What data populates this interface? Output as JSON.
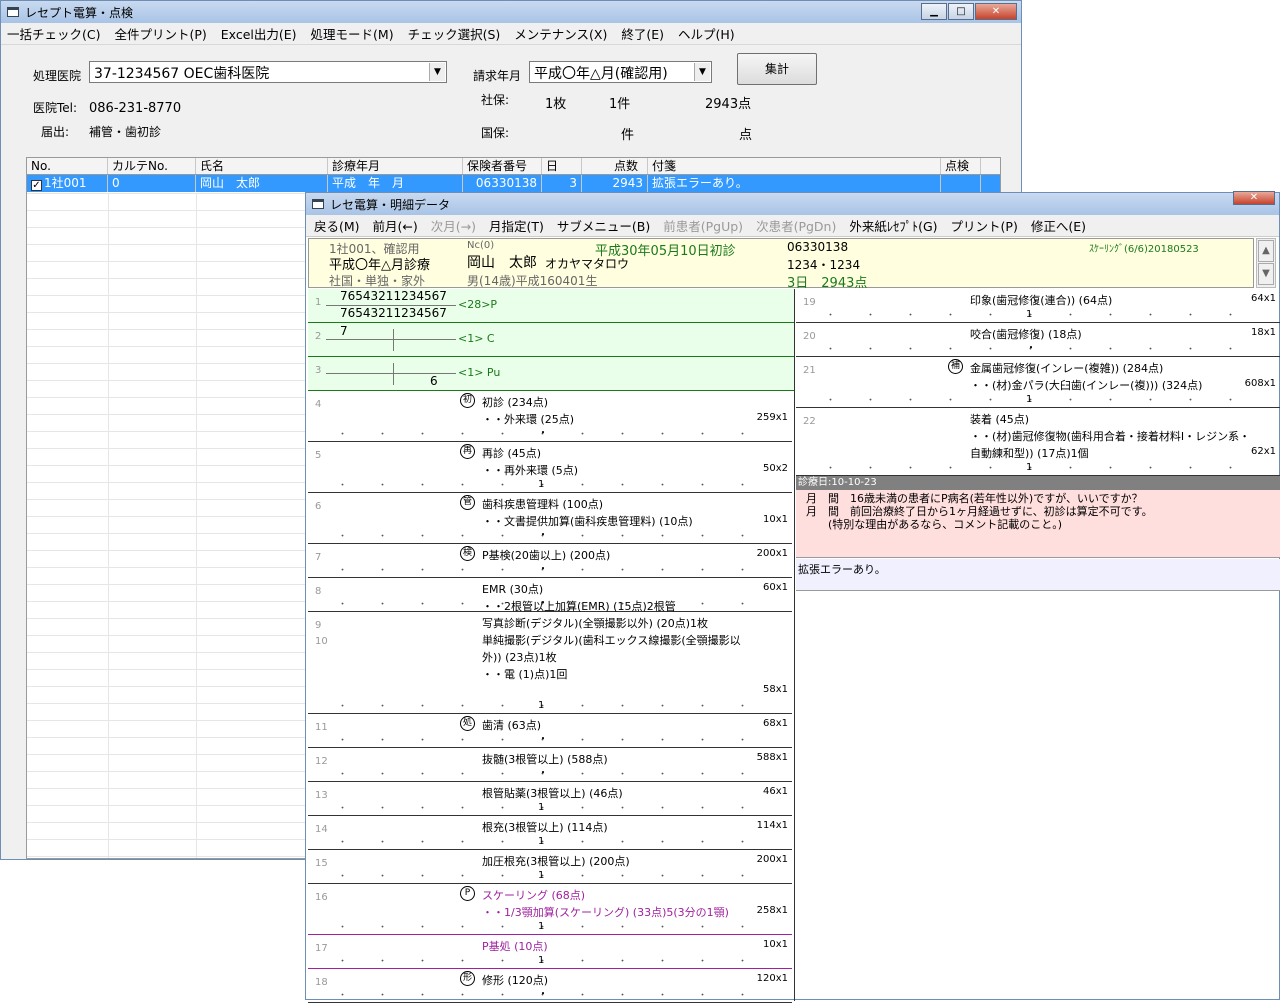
{
  "main": {
    "title": "レセプト電算・点検",
    "menu": [
      "一括チェック(C)",
      "全件プリント(P)",
      "Excel出力(E)",
      "処理モード(M)",
      "チェック選択(S)",
      "メンテナンス(X)",
      "終了(E)",
      "ヘルプ(H)"
    ],
    "clinic_label": "処理医院",
    "clinic_value": "37-1234567 OEC歯科医院",
    "month_label": "請求年月",
    "month_value": "平成〇年△月(確認用)",
    "tally_button": "集計",
    "tel_label": "医院Tel:",
    "tel_value": "086-231-8770",
    "notify_label": "届出:",
    "notify_value": "補管・歯初診",
    "shaho_label": "社保:",
    "shaho_sheets": "1枚",
    "shaho_cases": "1件",
    "shaho_points": "2943点",
    "kokuho_label": "国保:",
    "kokuho_cases": "件",
    "kokuho_points": "点",
    "columns": [
      "No.",
      "カルテNo.",
      "氏名",
      "診療年月",
      "保険者番号",
      "日",
      "点数",
      "付箋",
      "点検"
    ],
    "row": {
      "check": "✓",
      "no": "1社001",
      "chart": "0",
      "name": "岡山　太郎",
      "ym": "平成　年　月",
      "insurer": "06330138",
      "days": "3",
      "points": "2943",
      "tag": "拡張エラーあり。",
      "inspect": ""
    }
  },
  "detail": {
    "title": "レセ電算・明細データ",
    "menu": [
      {
        "label": "戻る(M)",
        "enabled": true
      },
      {
        "label": "前月(←)",
        "enabled": true
      },
      {
        "label": "次月(→)",
        "enabled": false
      },
      {
        "label": "月指定(T)",
        "enabled": true
      },
      {
        "label": "サブメニュー(B)",
        "enabled": true
      },
      {
        "label": "前患者(PgUp)",
        "enabled": false
      },
      {
        "label": "次患者(PgDn)",
        "enabled": false
      },
      {
        "label": "外来紙ﾚｾﾌﾟﾄ(G)",
        "enabled": true
      },
      {
        "label": "プリント(P)",
        "enabled": true
      },
      {
        "label": "修正へ(E)",
        "enabled": true
      }
    ],
    "info": {
      "line1": "1社001、確認用",
      "period": "平成〇年△月診療",
      "category": "社国・単独・家外",
      "nc": "Nc(0)",
      "patient": "岡山　太郎",
      "kana": "オカヤマタロウ",
      "sexage": "男(14歳)平成160401生",
      "firstvisit": "平成30年05月10日初診",
      "insurer": "06330138",
      "card": "1234・1234",
      "days_points": "3日　2943点",
      "scaling": "ｽｹｰﾘﾝｸﾞ(6/6)20180523"
    },
    "left_rows": [
      {
        "n": "1",
        "tooth_a": "76543211234567",
        "tooth_b": "76543211234567",
        "dx": "<28>P"
      },
      {
        "n": "2",
        "tooth_a": "7",
        "dx": "<1> C"
      },
      {
        "n": "3",
        "tooth_b": "6",
        "dx": "<1> Pu"
      },
      {
        "n": "4",
        "badge": "初",
        "l1": "初診 (234点)",
        "l2": "・・外来環 (25点)",
        "count": "259x1",
        "mark": "・"
      },
      {
        "n": "5",
        "badge": "再",
        "l1": "再診 (45点)",
        "l2": "・・再外来環 (5点)",
        "count": "50x2",
        "mark": "1"
      },
      {
        "n": "6",
        "badge": "管",
        "l1": "歯科疾患管理料 (100点)",
        "l2": "・・文書提供加算(歯科疾患管理料) (10点)",
        "count": "10x1",
        "mark": "・"
      },
      {
        "n": "7",
        "badge": "検",
        "l1": "P基検(20歯以上) (200点)",
        "count": "200x1",
        "mark": "・"
      },
      {
        "n": "8",
        "l1": "EMR (30点)",
        "l2": "・・2根管以上加算(EMR) (15点)2根管",
        "count": "60x1",
        "mark": "・"
      },
      {
        "n": "9",
        "n2": "10",
        "l1": "写真診断(デジタル)(全顎撮影以外) (20点)1枚",
        "l2": "単純撮影(デジタル)(歯科エックス線撮影(全顎撮影以",
        "l3": "外)) (23点)1枚",
        "l4": "・・電 (1)点)1回",
        "count": "58x1",
        "mark": "1"
      },
      {
        "n": "11",
        "badge": "処",
        "l1": "歯清 (63点)",
        "count": "68x1",
        "mark": "・"
      },
      {
        "n": "12",
        "l1": "抜髄(3根管以上) (588点)",
        "count": "588x1",
        "mark": "・"
      },
      {
        "n": "13",
        "l1": "根管貼薬(3根管以上) (46点)",
        "count": "46x1",
        "mark": "1"
      },
      {
        "n": "14",
        "l1": "根充(3根管以上) (114点)",
        "count": "114x1",
        "mark": "1"
      },
      {
        "n": "15",
        "l1": "加圧根充(3根管以上) (200点)",
        "count": "200x1",
        "mark": "1"
      },
      {
        "n": "16",
        "badge": "P",
        "l1": "スケーリング (68点)",
        "l2": "・・1/3顎加算(スケーリング) (33点)5(3分の1顎)",
        "count": "258x1",
        "mark": "1",
        "purple": true
      },
      {
        "n": "17",
        "l1": "P基処 (10点)",
        "count": "10x1",
        "mark": "1",
        "purple": true
      },
      {
        "n": "18",
        "badge": "形",
        "l1": "修形 (120点)",
        "count": "120x1",
        "mark": "・"
      }
    ],
    "right_rows": [
      {
        "n": "19",
        "l1": "印象(歯冠修復(連合)) (64点)",
        "count": "64x1",
        "mark": "1"
      },
      {
        "n": "20",
        "l1": "咬合(歯冠修復) (18点)",
        "count": "18x1",
        "mark": "・"
      },
      {
        "n": "21",
        "badge": "補",
        "l1": "金属歯冠修復(インレー(複雑)) (284点)",
        "l2": "・・(材)金パラ(大臼歯(インレー(複))) (324点)",
        "count": "608x1",
        "mark": "1"
      },
      {
        "n": "22",
        "l1": "装着 (45点)",
        "l2": "・・(材)歯冠修復物(歯科用合着・接着材料Ⅰ・レジン系・",
        "l3": "自動練和型)) (17点)1個",
        "count": "62x1",
        "mark": "1"
      }
    ],
    "date": "診療日:10-10-23",
    "warnings": [
      "月　間　16歳未満の患者にP病名(若年性以外)ですが、いいですか？",
      "月　間　前回治療終了日から1ヶ月経過せずに、初診は算定不可です。",
      "　　(特別な理由があるなら、コメント記載のこと。)"
    ],
    "note": "拡張エラーあり。"
  }
}
